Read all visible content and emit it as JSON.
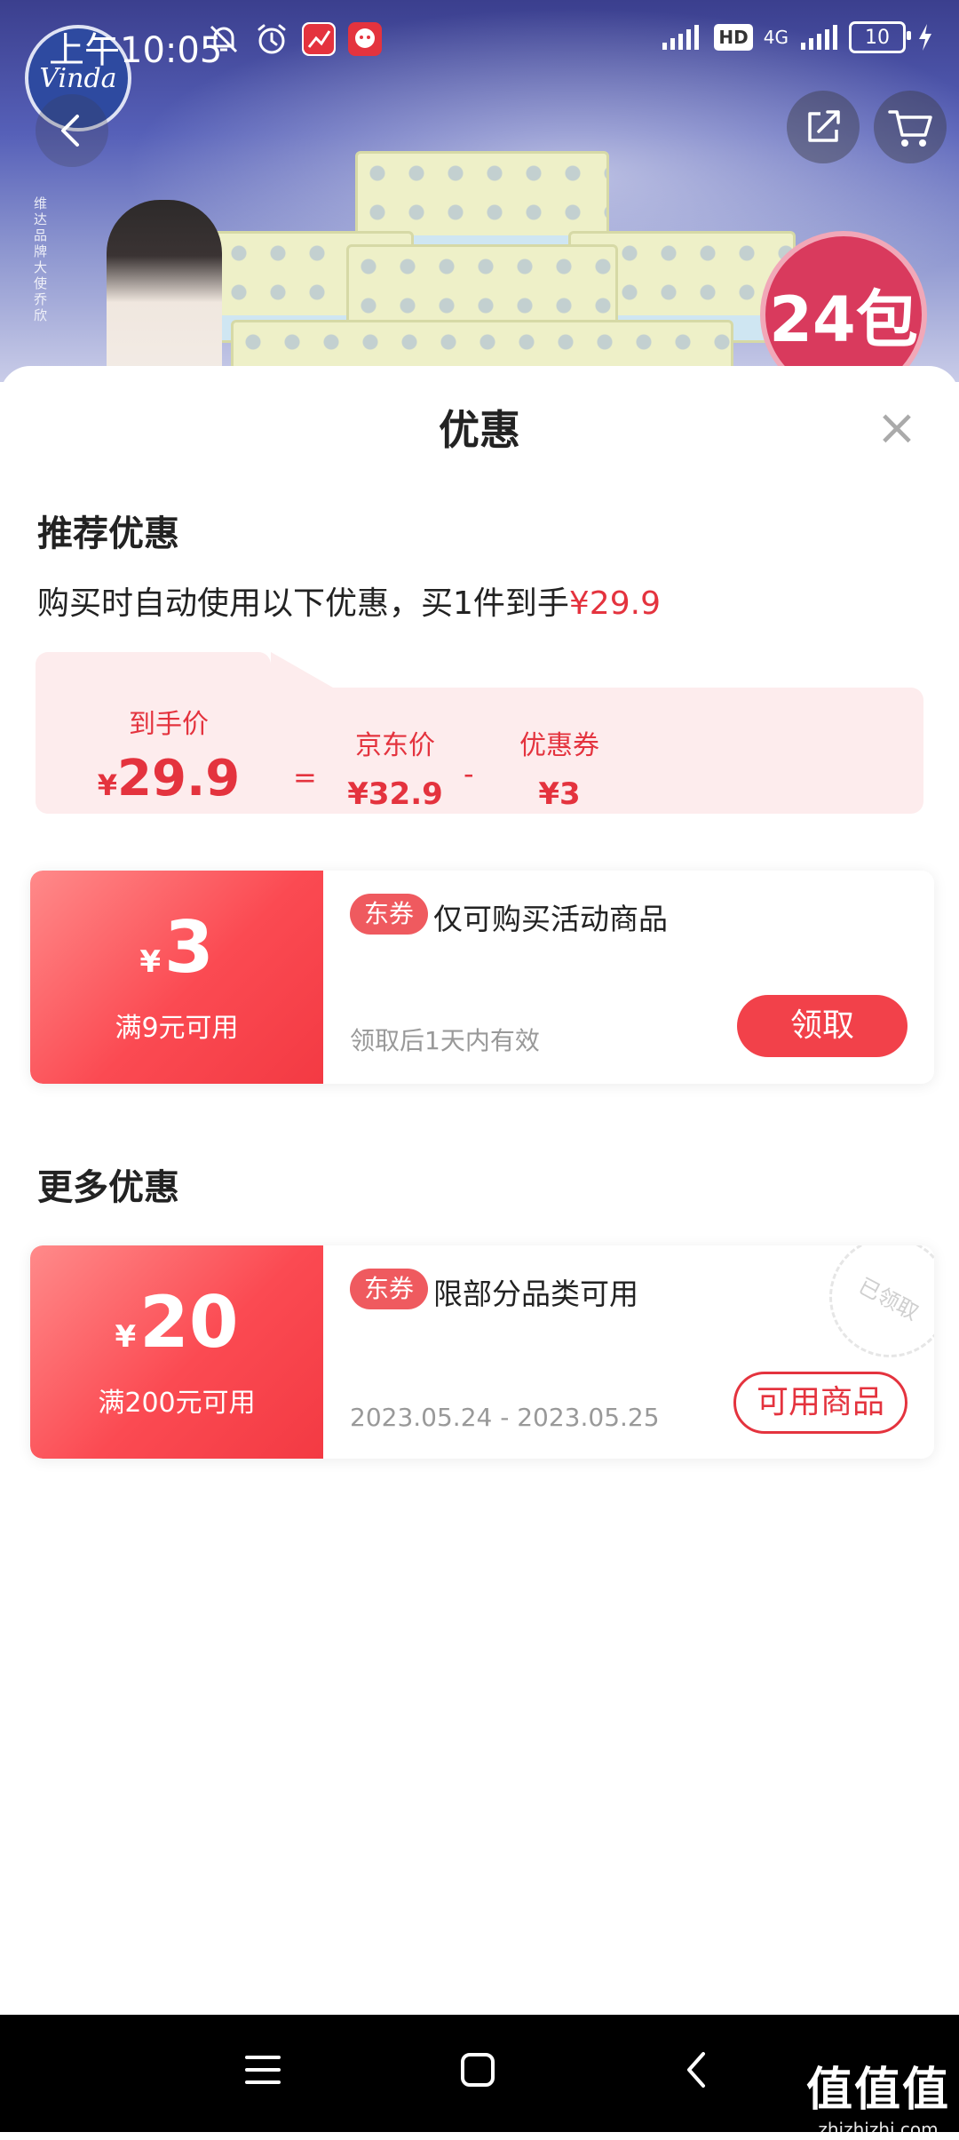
{
  "status_bar": {
    "time": "上午10:05",
    "network": "4G",
    "hd": "HD",
    "battery": "10"
  },
  "hero": {
    "brand_logo_text": "Vinda",
    "brand_side_text": "维达品牌大使 乔欣",
    "pack_count_badge": "24包"
  },
  "sheet": {
    "title": "优惠",
    "close_label": "×",
    "recommended": {
      "title": "推荐优惠",
      "desc_prefix": "购买时自动使用以下优惠，买1件到手",
      "desc_price": "¥29.9"
    },
    "breakdown": {
      "final_label": "到手价",
      "final_yen": "¥",
      "final_value": "29.9",
      "eq": "=",
      "jd_label": "京东价",
      "jd_value": "¥32.9",
      "minus": "-",
      "coupon_label": "优惠券",
      "coupon_value": "¥3"
    },
    "coupons": [
      {
        "yen": "¥",
        "amount": "3",
        "condition": "满9元可用",
        "tag": "东券",
        "title": "仅可购买活动商品",
        "validity": "领取后1天内有效",
        "button": "领取"
      }
    ],
    "more": {
      "title": "更多优惠",
      "coupons": [
        {
          "yen": "¥",
          "amount": "20",
          "condition": "满200元可用",
          "tag": "东券",
          "title": "限部分品类可用",
          "validity": "2023.05.24 - 2023.05.25",
          "button": "可用商品",
          "stamp": "已领取"
        }
      ]
    }
  },
  "watermark": {
    "big": "值值值",
    "small": "zhizhizhi.com"
  }
}
